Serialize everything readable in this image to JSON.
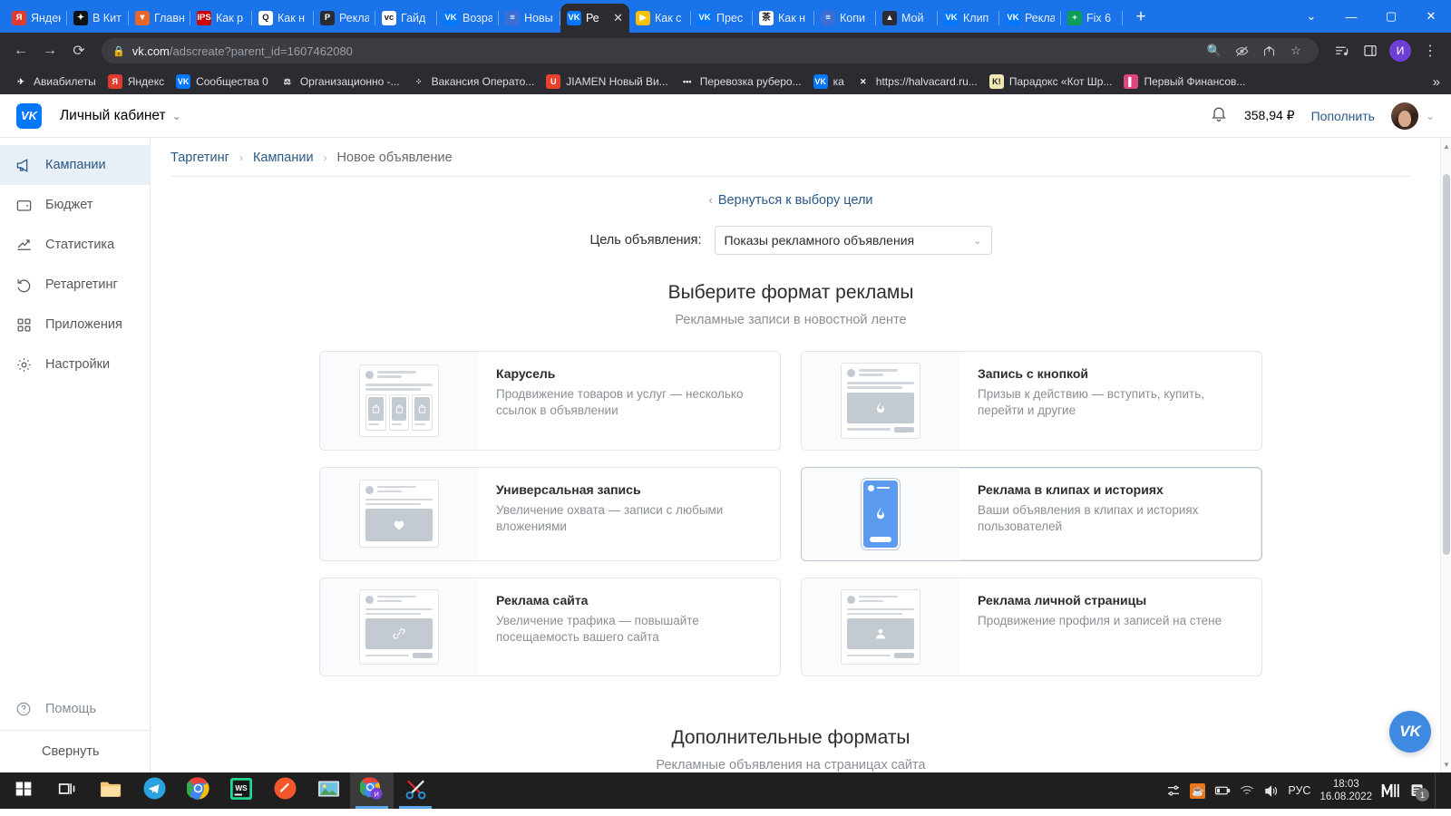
{
  "browser": {
    "tabs": [
      {
        "label": "Яндек",
        "favicon": "yandex-icon",
        "color": "#e03b2f",
        "glyph": "Я",
        "active": false
      },
      {
        "label": "В Кит",
        "favicon": "vkit-icon",
        "color": "#111111",
        "glyph": "✦",
        "active": false
      },
      {
        "label": "Главн",
        "favicon": "orange-icon",
        "color": "#e8662a",
        "glyph": "▼",
        "active": false
      },
      {
        "label": "Как р",
        "favicon": "ips-icon",
        "color": "#cc0000",
        "glyph": "IPS",
        "active": false
      },
      {
        "label": "Как н",
        "favicon": "qiwi-icon",
        "color": "#ffffff",
        "glyph": "Q",
        "active": false
      },
      {
        "label": "Рекла",
        "favicon": "p-icon",
        "color": "#2b2b31",
        "glyph": "Р",
        "active": false
      },
      {
        "label": "Гайд",
        "favicon": "vcru-icon",
        "color": "#ffffff",
        "glyph": "vc",
        "active": false
      },
      {
        "label": "Возра",
        "favicon": "vk-icon",
        "color": "#0077ff",
        "glyph": "VK",
        "active": false
      },
      {
        "label": "Новы",
        "favicon": "list-icon",
        "color": "#3b6fd4",
        "glyph": "≡",
        "active": false
      },
      {
        "label": "Ре",
        "favicon": "vk-icon",
        "color": "#0077ff",
        "glyph": "VK",
        "active": true
      },
      {
        "label": "Как с",
        "favicon": "youtube-icon",
        "color": "#ffc107",
        "glyph": "▶",
        "active": false
      },
      {
        "label": "Прес",
        "favicon": "vk-icon",
        "color": "#0077ff",
        "glyph": "VK",
        "active": false
      },
      {
        "label": "Как н",
        "favicon": "kanji-icon",
        "color": "#ffffff",
        "glyph": "茶",
        "active": false
      },
      {
        "label": "Копи",
        "favicon": "list-icon",
        "color": "#3b6fd4",
        "glyph": "≡",
        "active": false
      },
      {
        "label": "Мой",
        "favicon": "google-drive-icon",
        "color": "#2b2b31",
        "glyph": "▲",
        "active": false
      },
      {
        "label": "Клип",
        "favicon": "vk-icon",
        "color": "#0077ff",
        "glyph": "VK",
        "active": false
      },
      {
        "label": "Рекла",
        "favicon": "vk-icon",
        "color": "#0077ff",
        "glyph": "VK",
        "active": false
      },
      {
        "label": "Fix 6",
        "favicon": "sheets-icon",
        "color": "#0f9d58",
        "glyph": "+",
        "active": false
      }
    ],
    "new_tab_label": "+",
    "tab_list_label": "⌄",
    "window_minimize": "—",
    "window_maximize": "▢",
    "window_close": "✕",
    "nav": {
      "back": "←",
      "forward": "→",
      "reload": "⟳"
    },
    "omnibox": {
      "lock_icon": "lock-icon",
      "url_domain": "vk.com",
      "url_path": "/adscreate?parent_id=1607462080"
    },
    "toolbar_icons": [
      "search-icon",
      "eye-off-icon",
      "share-icon",
      "star-icon",
      "reading-list-icon",
      "side-panel-icon"
    ],
    "profile_initial": "И",
    "menu_icon": "⋮",
    "bookmarks": [
      {
        "label": "Авиабилеты",
        "icon": "plane-icon",
        "color": "#2b2b31",
        "glyph": "✈"
      },
      {
        "label": "Яндекс",
        "icon": "yandex-icon",
        "color": "#e03b2f",
        "glyph": "Я"
      },
      {
        "label": "Сообщества 0",
        "icon": "vk-icon",
        "color": "#0077ff",
        "glyph": "VK"
      },
      {
        "label": "Организационно -...",
        "icon": "scales-icon",
        "color": "#2b2b31",
        "glyph": "⚖"
      },
      {
        "label": "Вакансия Операто...",
        "icon": "dots-icon",
        "color": "#2b2b31",
        "glyph": "⁘"
      },
      {
        "label": "JIAMEN Новый Ви...",
        "icon": "opera-icon",
        "color": "#e8422e",
        "glyph": "U"
      },
      {
        "label": "Перевозка руберо...",
        "icon": "teal-dots-icon",
        "color": "#2b2b31",
        "glyph": "•••"
      },
      {
        "label": "ка",
        "icon": "vk-icon",
        "color": "#0077ff",
        "glyph": "VK"
      },
      {
        "label": "https://halvacard.ru...",
        "icon": "halva-icon",
        "color": "#2b2b31",
        "glyph": "✕"
      },
      {
        "label": "Парадокс «Кот Шр...",
        "icon": "k-icon",
        "color": "#f2e9b0",
        "glyph": "K!"
      },
      {
        "label": "Первый Финансов...",
        "icon": "pink-icon",
        "color": "#e0457b",
        "glyph": "▌"
      }
    ],
    "bookmarks_overflow": "»"
  },
  "vk": {
    "account_title": "Личный кабинет",
    "account_chevron": "⌄",
    "bell_icon": "bell-icon",
    "balance": "358,94 ₽",
    "topup_label": "Пополнить",
    "avatar_chevron": "⌄",
    "sidebar": {
      "items": [
        {
          "label": "Кампании",
          "icon": "megaphone-icon",
          "active": true
        },
        {
          "label": "Бюджет",
          "icon": "wallet-icon",
          "active": false
        },
        {
          "label": "Статистика",
          "icon": "chart-up-icon",
          "active": false
        },
        {
          "label": "Ретаргетинг",
          "icon": "history-icon",
          "active": false
        },
        {
          "label": "Приложения",
          "icon": "apps-grid-icon",
          "active": false
        },
        {
          "label": "Настройки",
          "icon": "gear-icon",
          "active": false
        }
      ],
      "help_label": "Помощь",
      "help_icon": "question-circle-icon",
      "collapse_label": "Свернуть"
    },
    "breadcrumb": [
      {
        "label": "Таргетинг",
        "current": false
      },
      {
        "label": "Кампании",
        "current": false
      },
      {
        "label": "Новое объявление",
        "current": true
      }
    ],
    "breadcrumb_sep": "›",
    "back_link": "Вернуться к выбору цели",
    "back_chevron": "‹",
    "goal_label": "Цель объявления:",
    "goal_value": "Показы рекламного объявления",
    "goal_chevron": "⌄",
    "format_section": {
      "title": "Выберите формат рекламы",
      "subtitle": "Рекламные записи в новостной ленте",
      "cards": [
        {
          "title": "Карусель",
          "desc": "Продвижение товаров и услуг — несколько ссылок в объявлении",
          "preview": "carousel-preview",
          "selected": false
        },
        {
          "title": "Запись с кнопкой",
          "desc": "Призыв к действию — вступить, купить, перейти и другие",
          "preview": "post-with-button-preview",
          "selected": false
        },
        {
          "title": "Универсальная запись",
          "desc": "Увеличение охвата — записи с любыми вложениями",
          "preview": "universal-post-preview",
          "selected": false
        },
        {
          "title": "Реклама в клипах и историях",
          "desc": "Ваши объявления в клипах и историях пользователей",
          "preview": "clips-stories-preview",
          "selected": true
        },
        {
          "title": "Реклама сайта",
          "desc": "Увеличение трафика — повышайте посещаемость вашего сайта",
          "preview": "site-ad-preview",
          "selected": false
        },
        {
          "title": "Реклама личной страницы",
          "desc": "Продвижение профиля и записей на стене",
          "preview": "personal-page-preview",
          "selected": false
        }
      ]
    },
    "extra_section": {
      "title": "Дополнительные форматы",
      "subtitle": "Рекламные объявления на страницах сайта"
    },
    "fab_label": "VK",
    "accent_color": "#0077ff",
    "link_color": "#2a5885"
  },
  "taskbar": {
    "items": [
      {
        "name": "start-button",
        "icon": "windows-icon"
      },
      {
        "name": "task-view-button",
        "icon": "task-view-icon"
      },
      {
        "name": "file-explorer",
        "icon": "folder-icon",
        "running": false
      },
      {
        "name": "telegram",
        "icon": "telegram-icon",
        "running": false
      },
      {
        "name": "chrome",
        "icon": "chrome-icon",
        "running": false
      },
      {
        "name": "webstorm",
        "icon": "webstorm-icon",
        "running": false
      },
      {
        "name": "orange-app",
        "icon": "pen-circle-icon",
        "running": false
      },
      {
        "name": "photos",
        "icon": "photo-icon",
        "running": false
      },
      {
        "name": "chrome-profile",
        "icon": "chrome-profile-icon",
        "running": true,
        "focused": true
      },
      {
        "name": "snipping-tool",
        "icon": "scissors-icon",
        "running": true
      }
    ],
    "tray": {
      "settings_icon": "sliders-icon",
      "java_icon": "java-icon",
      "battery_icon": "battery-icon",
      "wifi_icon": "wifi-icon",
      "volume_icon": "volume-icon",
      "language": "РУС",
      "time": "18:03",
      "date": "16.08.2022",
      "mail_icon": "mail-ru-icon",
      "notification_icon": "notifications-icon",
      "notification_count": "1"
    }
  }
}
